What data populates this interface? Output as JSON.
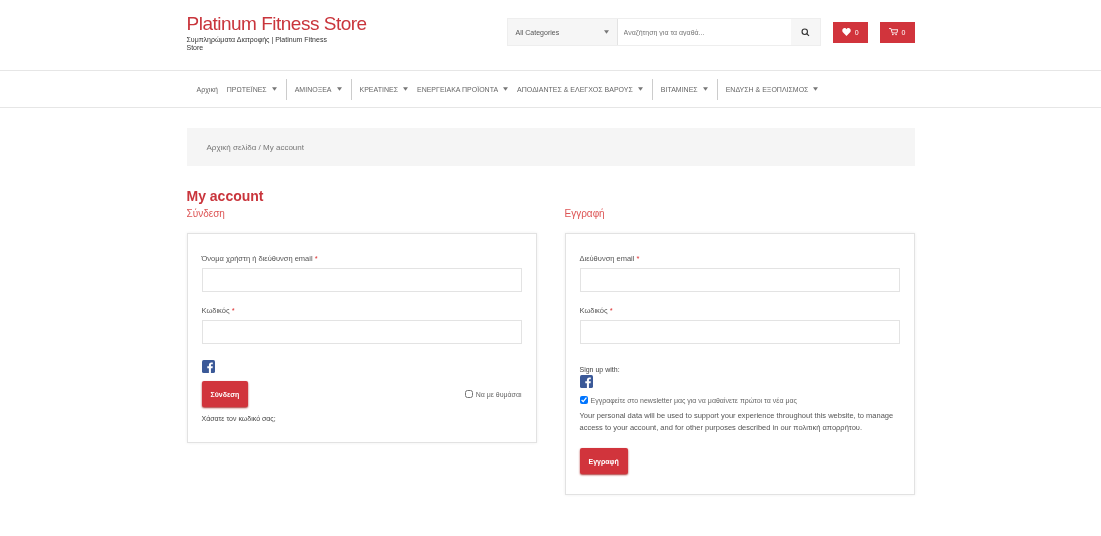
{
  "logo": {
    "title": "Platinum Fitness Store",
    "tagline": "Συμπληρώματα Διατροφής | Platinum Fitness Store"
  },
  "search": {
    "category": "All Categories",
    "placeholder": "Αναζήτηση για τα αγαθά..."
  },
  "wishlist": {
    "count": "0"
  },
  "cart": {
    "count": "0"
  },
  "nav": [
    {
      "label": "Αρχική",
      "has_menu": false,
      "divider": false
    },
    {
      "label": "ΠΡΩΤΕΪΝΕΣ",
      "has_menu": true,
      "divider": false
    },
    {
      "label": "ΑΜΙΝΟΞΕΑ",
      "has_menu": true,
      "divider": true
    },
    {
      "label": "ΚΡΕΑΤΙΝΕΣ",
      "has_menu": true,
      "divider": true
    },
    {
      "label": "ΕΝΕΡΓΕΙΑΚΑ ΠΡΟΪΟΝΤΑ",
      "has_menu": true,
      "divider": false
    },
    {
      "label": "ΑΠΟΔΙΑΝΤΕΣ & ΕΛΕΓΧΟΣ ΒΑΡΟΥΣ",
      "has_menu": true,
      "divider": false
    },
    {
      "label": "ΒΙΤΑΜΙΝΕΣ",
      "has_menu": true,
      "divider": true
    },
    {
      "label": "ΕΝΔΥΣΗ & ΕΞΟΠΛΙΣΜΟΣ",
      "has_menu": true,
      "divider": true
    }
  ],
  "breadcrumb": "Αρχική σελίδα / My account",
  "page_title": "My account",
  "login": {
    "heading": "Σύνδεση",
    "fields": [
      {
        "label": "Όνομα χρήστη ή διεύθυνση email",
        "required": "*"
      },
      {
        "label": "Κωδικός",
        "required": "*"
      }
    ],
    "button": "Σύνδεση",
    "remember": {
      "label": "Να με θυμάσαι",
      "checked": false
    },
    "lost_password": "Χάσατε τον κωδικό σας;"
  },
  "register": {
    "heading": "Εγγραφή",
    "fields": [
      {
        "label": "Διεύθυνση email",
        "required": "*"
      },
      {
        "label": "Κωδικός",
        "required": "*"
      }
    ],
    "signup_with": "Sign up with:",
    "newsletter": {
      "label": "Εγγραφείτε στο newsletter μας για να μαθαίνετε πρώτοι τα νέα μας",
      "checked": true
    },
    "privacy": "Your personal data will be used to support your experience throughout this website, to manage access to your account, and for other purposes described in our πολιτική απορρήτου.",
    "button": "Εγγραφή"
  }
}
